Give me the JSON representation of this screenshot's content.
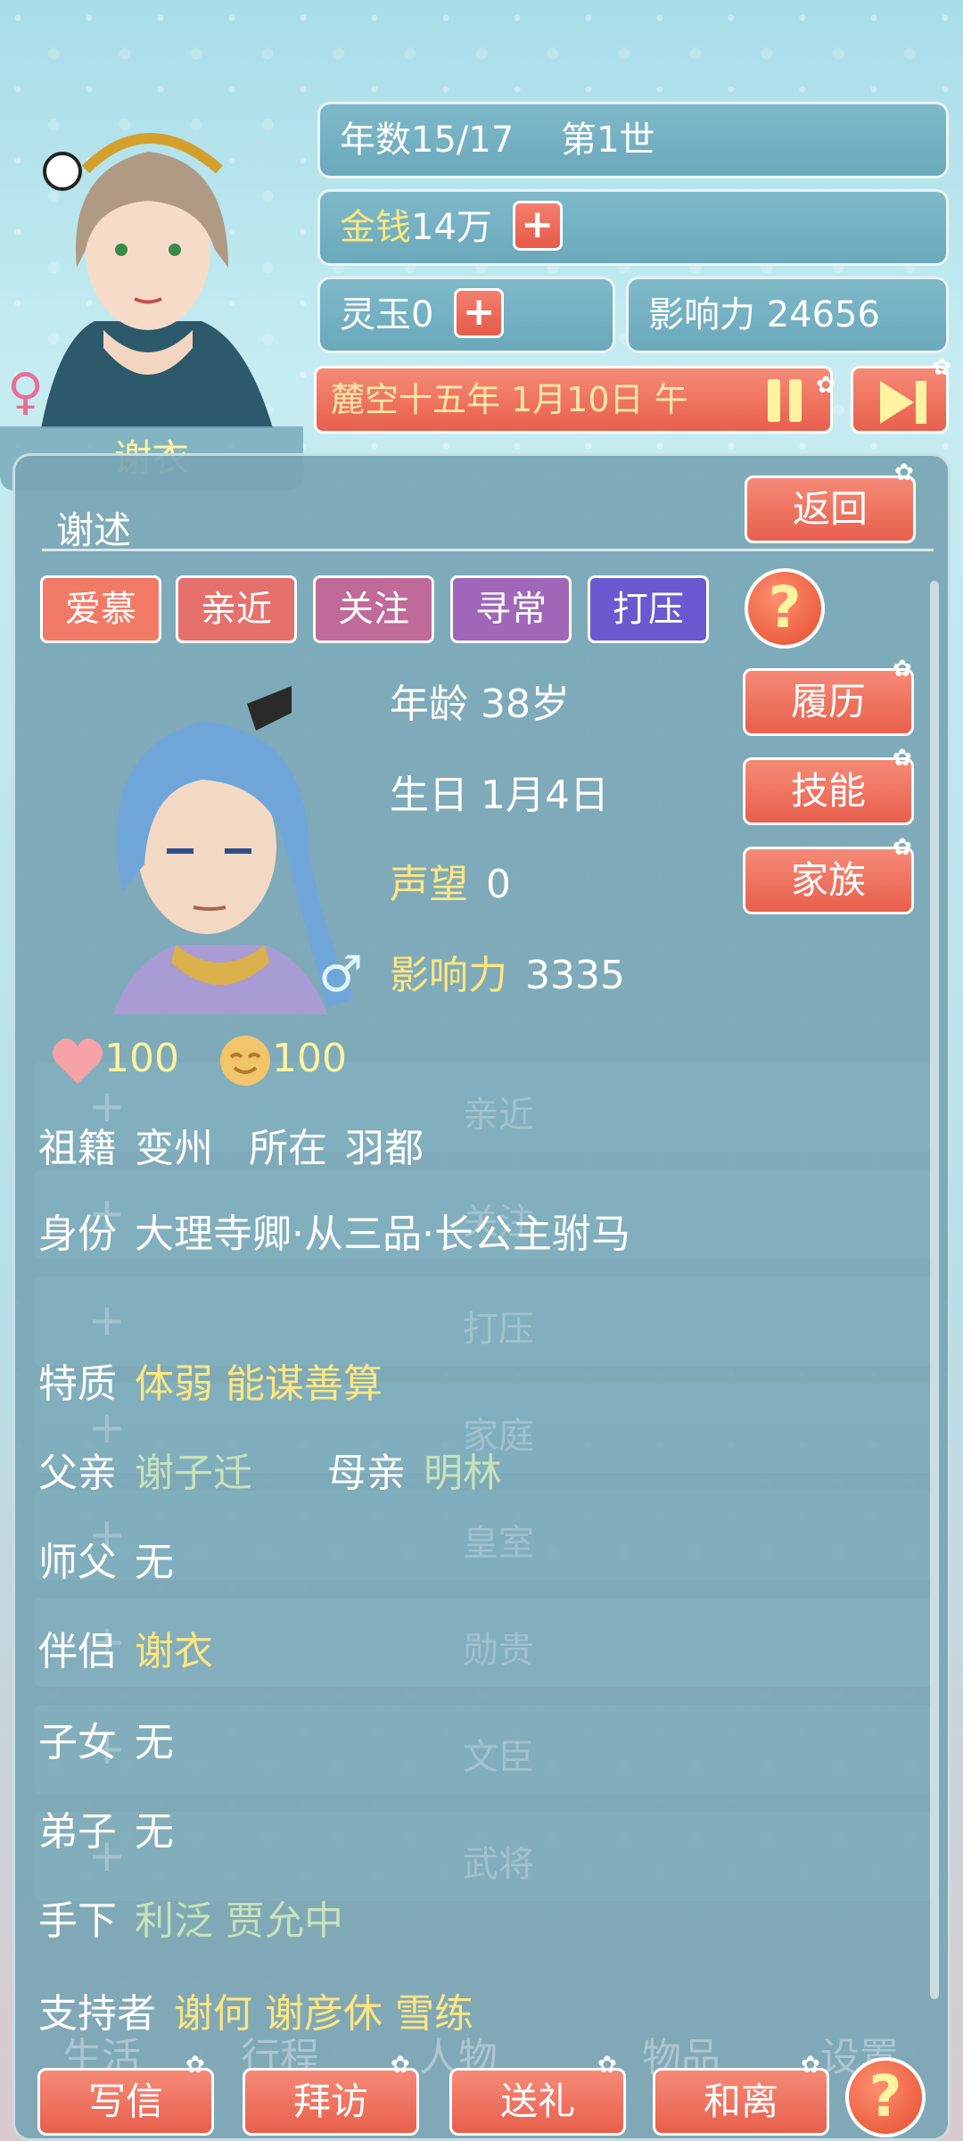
{
  "header": {
    "avatar_name": "谢衣",
    "years": "年数15/17",
    "generation": "第1世",
    "money_label": "金钱",
    "money_value": "14万",
    "jade_label": "灵玉",
    "jade_value": "0",
    "influence": "影响力 24656",
    "date": "麓空十五年 1月10日 午",
    "plus": "+"
  },
  "panel": {
    "title": "谢述",
    "back": "返回",
    "tabs": [
      {
        "label": "爱慕",
        "color": "#f07a66"
      },
      {
        "label": "亲近",
        "color": "#e6706c"
      },
      {
        "label": "关注",
        "color": "#c06a9a"
      },
      {
        "label": "寻常",
        "color": "#a067b8"
      },
      {
        "label": "打压",
        "color": "#6a58d0"
      }
    ],
    "help": "?",
    "stats": {
      "age": "年龄 38岁",
      "birthday": "生日 1月4日",
      "fame_label": "声望",
      "fame_value": "0",
      "influence_label": "影响力",
      "influence_value": "3335"
    },
    "side_buttons": {
      "resume": "履历",
      "skills": "技能",
      "clan": "家族"
    },
    "love": "100",
    "mood": "100",
    "details": {
      "origin_label": "祖籍",
      "origin": "变州",
      "location_label": "所在",
      "location": "羽都",
      "identity_label": "身份",
      "identity": "大理寺卿·从三品·长公主驸马",
      "traits_label": "特质",
      "traits": "体弱 能谋善算",
      "father_label": "父亲",
      "father": "谢子迁",
      "mother_label": "母亲",
      "mother": "明林",
      "master_label": "师父",
      "master": "无",
      "spouse_label": "伴侣",
      "spouse": "谢衣",
      "children_label": "子女",
      "children": "无",
      "disciples_label": "弟子",
      "disciples": "无",
      "subordinates_label": "手下",
      "subordinates": "利泛 贾允中",
      "supporters_label": "支持者",
      "supporters": "谢何 谢彦休 雪练"
    },
    "background_rows": [
      "亲近",
      "关注",
      "打压",
      "家庭",
      "皇室",
      "勋贵",
      "文臣",
      "武将"
    ]
  },
  "bottom_nav_bg": [
    "生活",
    "行程",
    "人物",
    "物品",
    "设置"
  ],
  "actions": {
    "write_letter": "写信",
    "visit": "拜访",
    "gift": "送礼",
    "divorce": "和离",
    "help": "?"
  }
}
